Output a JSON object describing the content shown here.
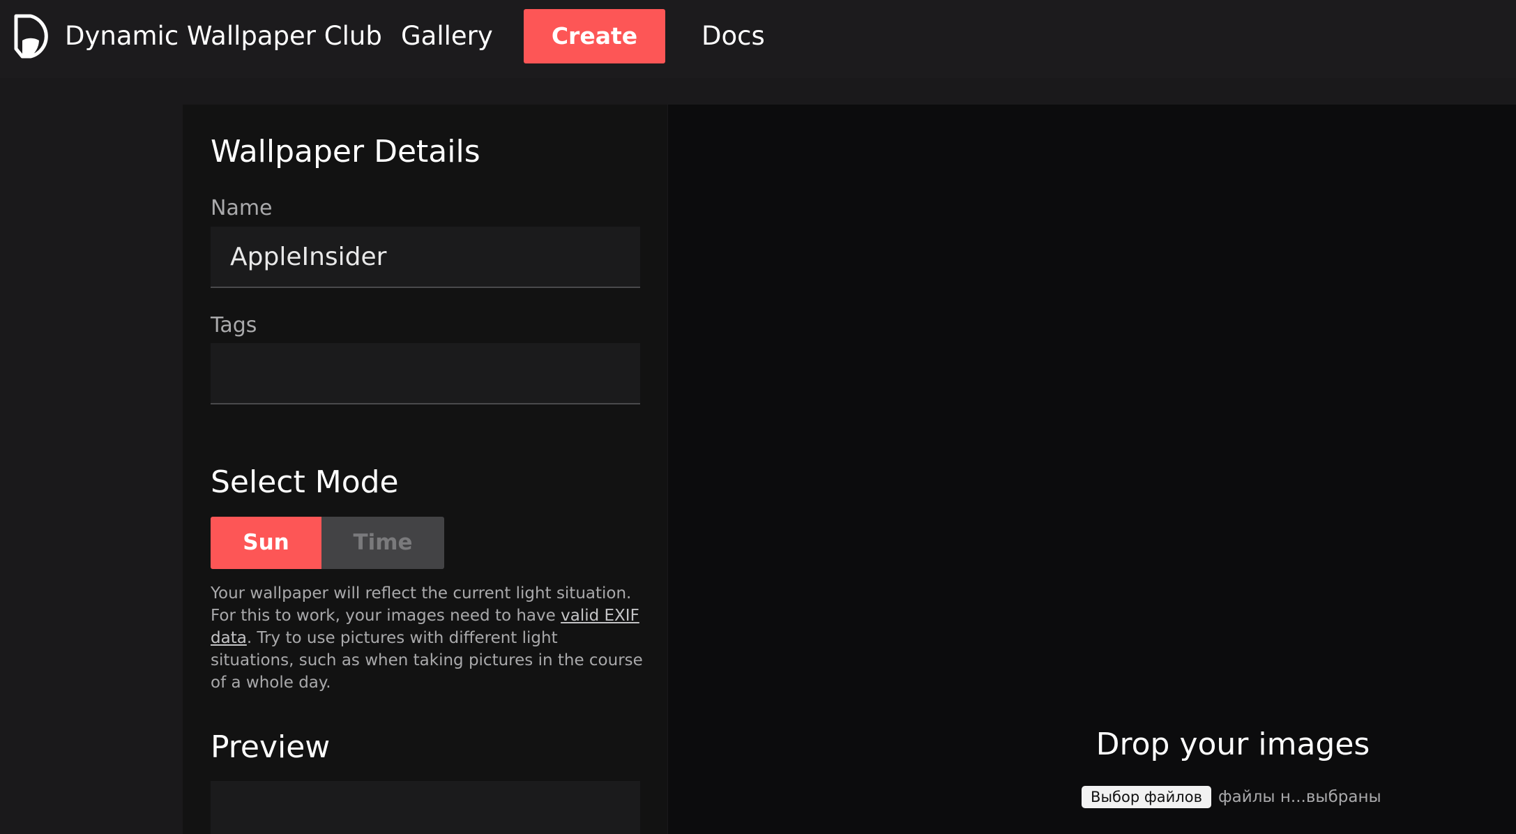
{
  "header": {
    "brand": "Dynamic Wallpaper Club",
    "logo_icon": "dynamic-wallpaper-logo-icon",
    "nav": {
      "gallery": "Gallery",
      "create": "Create",
      "docs": "Docs"
    }
  },
  "details": {
    "title": "Wallpaper Details",
    "name_label": "Name",
    "name_value": "AppleInsider",
    "tags_label": "Tags",
    "tags_value": ""
  },
  "mode": {
    "title": "Select Mode",
    "sun_label": "Sun",
    "time_label": "Time",
    "selected": "Sun",
    "desc_before": "Your wallpaper will reflect the current light situation. For this to work, your images need to have ",
    "desc_link": "valid EXIF data",
    "desc_after": ". Try to use pictures with different light situations, such as when taking pictures in the course of a whole day."
  },
  "preview": {
    "title": "Preview"
  },
  "dropzone": {
    "title": "Drop your images",
    "file_button": "Выбор файлов",
    "file_status": "файлы н...выбраны"
  },
  "colors": {
    "accent": "#fd5656",
    "background": "#1a191b",
    "panel": "#121212",
    "dropzone": "#0c0c0d"
  }
}
